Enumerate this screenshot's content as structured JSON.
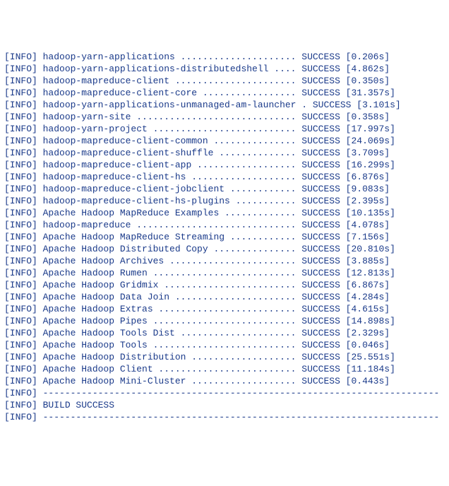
{
  "tag": "[INFO]",
  "status": "SUCCESS",
  "dash_line": "------------------------------------------------------------------------",
  "build_success": "BUILD SUCCESS",
  "modules": [
    {
      "name": "hadoop-yarn-applications",
      "time": "0.206s"
    },
    {
      "name": "hadoop-yarn-applications-distributedshell",
      "time": "4.862s"
    },
    {
      "name": "hadoop-mapreduce-client",
      "time": "0.350s"
    },
    {
      "name": "hadoop-mapreduce-client-core",
      "time": "31.357s"
    },
    {
      "name": "hadoop-yarn-applications-unmanaged-am-launcher",
      "time": "3.101s"
    },
    {
      "name": "hadoop-yarn-site",
      "time": "0.358s"
    },
    {
      "name": "hadoop-yarn-project",
      "time": "17.997s"
    },
    {
      "name": "hadoop-mapreduce-client-common",
      "time": "24.069s"
    },
    {
      "name": "hadoop-mapreduce-client-shuffle",
      "time": "3.709s"
    },
    {
      "name": "hadoop-mapreduce-client-app",
      "time": "16.299s"
    },
    {
      "name": "hadoop-mapreduce-client-hs",
      "time": "6.876s"
    },
    {
      "name": "hadoop-mapreduce-client-jobclient",
      "time": "9.083s"
    },
    {
      "name": "hadoop-mapreduce-client-hs-plugins",
      "time": "2.395s"
    },
    {
      "name": "Apache Hadoop MapReduce Examples",
      "time": "10.135s"
    },
    {
      "name": "hadoop-mapreduce",
      "time": "4.078s"
    },
    {
      "name": "Apache Hadoop MapReduce Streaming",
      "time": "7.156s"
    },
    {
      "name": "Apache Hadoop Distributed Copy",
      "time": "20.810s"
    },
    {
      "name": "Apache Hadoop Archives",
      "time": "3.885s"
    },
    {
      "name": "Apache Hadoop Rumen",
      "time": "12.813s"
    },
    {
      "name": "Apache Hadoop Gridmix",
      "time": "6.867s"
    },
    {
      "name": "Apache Hadoop Data Join",
      "time": "4.284s"
    },
    {
      "name": "Apache Hadoop Extras",
      "time": "4.615s"
    },
    {
      "name": "Apache Hadoop Pipes",
      "time": "14.898s"
    },
    {
      "name": "Apache Hadoop Tools Dist",
      "time": "2.329s"
    },
    {
      "name": "Apache Hadoop Tools",
      "time": "0.046s"
    },
    {
      "name": "Apache Hadoop Distribution",
      "time": "25.551s"
    },
    {
      "name": "Apache Hadoop Client",
      "time": "11.184s"
    },
    {
      "name": "Apache Hadoop Mini-Cluster",
      "time": "0.443s"
    }
  ]
}
